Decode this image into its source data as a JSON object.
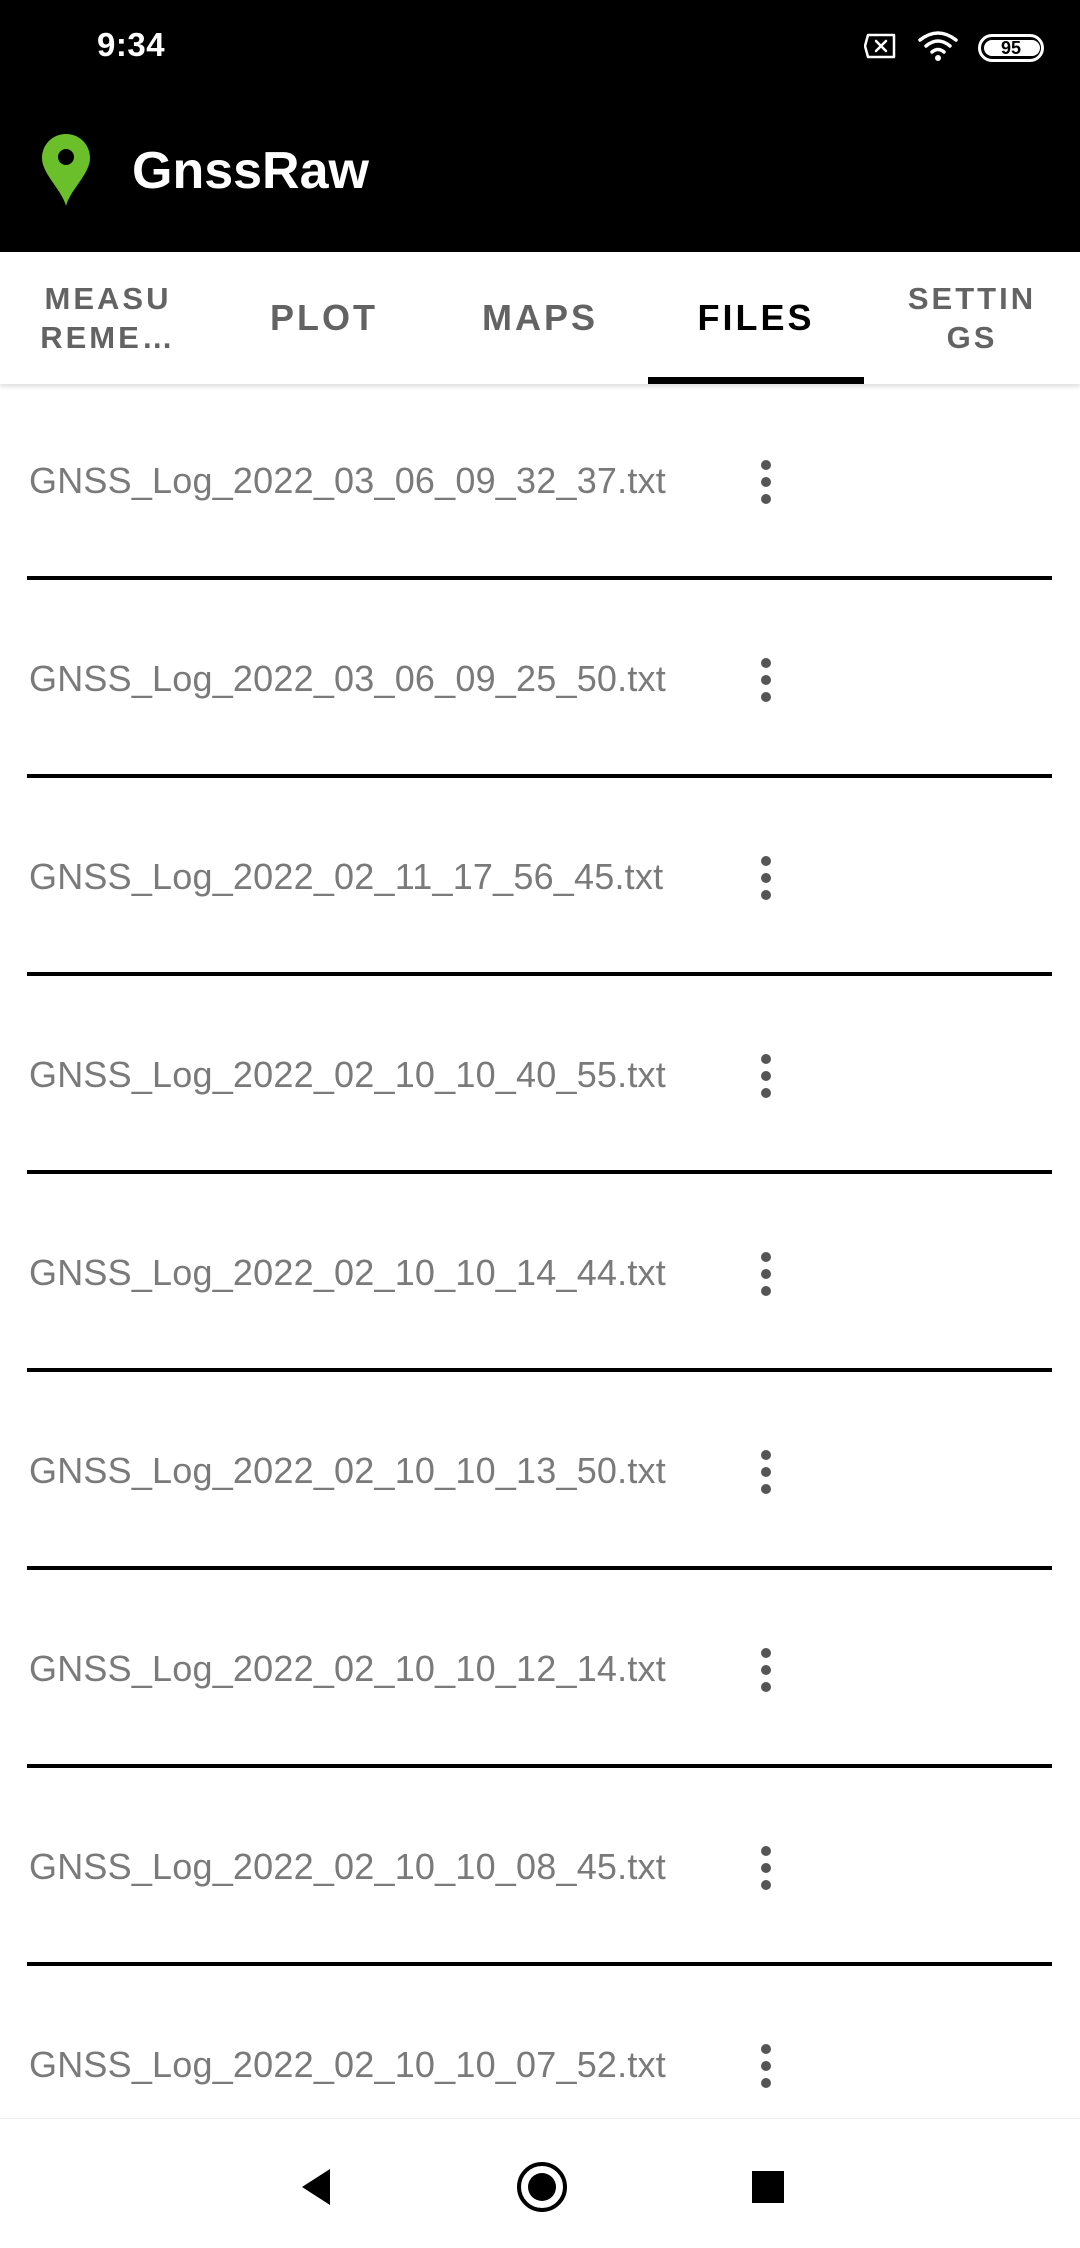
{
  "status_bar": {
    "time": "9:34",
    "battery_level": "95",
    "icons": [
      "sim-x-icon",
      "wifi-icon",
      "battery-icon"
    ]
  },
  "app_bar": {
    "title": "GnssRaw",
    "logo_icon": "map-pin-icon",
    "logo_color": "#6abf2a"
  },
  "tabs": [
    {
      "label": "MEASU\nREME…",
      "active": false
    },
    {
      "label": "PLOT",
      "active": false
    },
    {
      "label": "MAPS",
      "active": false
    },
    {
      "label": "FILES",
      "active": true
    },
    {
      "label": "SETTIN\nGS",
      "active": false
    }
  ],
  "files": [
    {
      "name": "GNSS_Log_2022_03_06_09_32_37.txt",
      "menu_icon": "more-vertical-icon"
    },
    {
      "name": "GNSS_Log_2022_03_06_09_25_50.txt",
      "menu_icon": "more-vertical-icon"
    },
    {
      "name": "GNSS_Log_2022_02_11_17_56_45.txt",
      "menu_icon": "more-vertical-icon"
    },
    {
      "name": "GNSS_Log_2022_02_10_10_40_55.txt",
      "menu_icon": "more-vertical-icon"
    },
    {
      "name": "GNSS_Log_2022_02_10_10_14_44.txt",
      "menu_icon": "more-vertical-icon"
    },
    {
      "name": "GNSS_Log_2022_02_10_10_13_50.txt",
      "menu_icon": "more-vertical-icon"
    },
    {
      "name": "GNSS_Log_2022_02_10_10_12_14.txt",
      "menu_icon": "more-vertical-icon"
    },
    {
      "name": "GNSS_Log_2022_02_10_10_08_45.txt",
      "menu_icon": "more-vertical-icon"
    },
    {
      "name": "GNSS_Log_2022_02_10_10_07_52.txt",
      "menu_icon": "more-vertical-icon"
    }
  ],
  "nav_bar": {
    "buttons": [
      "back-icon",
      "home-icon",
      "recents-icon"
    ]
  }
}
